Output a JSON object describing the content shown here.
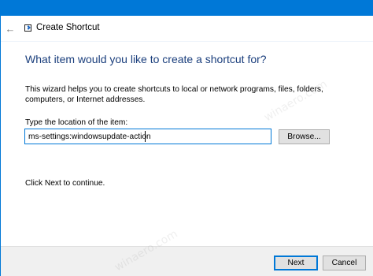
{
  "window": {
    "title": "Create Shortcut",
    "back_glyph": "←",
    "icons": {
      "back": "back-arrow-icon",
      "app": "shortcut-icon"
    }
  },
  "main": {
    "heading": "What item would you like to create a shortcut for?",
    "description": "This wizard helps you to create shortcuts to local or network programs, files, folders, computers, or Internet addresses.",
    "location_label": "Type the location of the item:",
    "location_value": "ms-settings:windowsupdate-action",
    "browse_label": "Browse...",
    "hint": "Click Next to continue."
  },
  "footer": {
    "next_label": "Next",
    "cancel_label": "Cancel"
  },
  "watermark": {
    "text": "winaero.com"
  },
  "colors": {
    "accent": "#0078d7",
    "heading": "#1a3e7c",
    "footer_bg": "#f0f0f0"
  }
}
